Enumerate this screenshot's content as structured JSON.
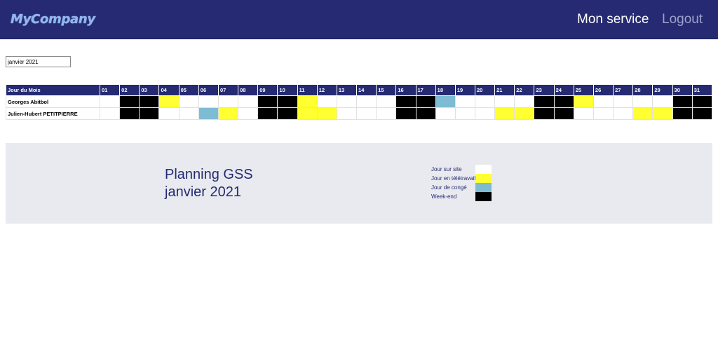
{
  "navbar": {
    "brand": "MyCompany",
    "links": [
      {
        "label": "Mon service"
      },
      {
        "label": "Logout"
      }
    ]
  },
  "month_selector": {
    "value": "janvier 2021"
  },
  "planning_table": {
    "header_label": "Jour du Mois",
    "days": [
      "01",
      "02",
      "03",
      "04",
      "05",
      "06",
      "07",
      "08",
      "09",
      "10",
      "11",
      "12",
      "13",
      "14",
      "15",
      "16",
      "17",
      "18",
      "19",
      "20",
      "21",
      "22",
      "23",
      "24",
      "25",
      "26",
      "27",
      "28",
      "29",
      "30",
      "31"
    ],
    "rows": [
      {
        "name": "Georges Abitbol",
        "days": [
          "site",
          "weekend",
          "weekend",
          "tele",
          "site",
          "site",
          "site",
          "site",
          "weekend",
          "weekend",
          "tele",
          "site",
          "site",
          "site",
          "site",
          "weekend",
          "weekend",
          "conge",
          "site",
          "site",
          "site",
          "site",
          "weekend",
          "weekend",
          "tele",
          "site",
          "site",
          "site",
          "site",
          "weekend",
          "weekend"
        ]
      },
      {
        "name": "Julien-Hubert PETITPIERRE",
        "days": [
          "site",
          "weekend",
          "weekend",
          "site",
          "site",
          "conge",
          "tele",
          "site",
          "weekend",
          "weekend",
          "tele",
          "tele",
          "site",
          "site",
          "site",
          "weekend",
          "weekend",
          "site",
          "site",
          "site",
          "tele",
          "tele",
          "weekend",
          "weekend",
          "site",
          "site",
          "site",
          "tele",
          "tele",
          "weekend",
          "weekend"
        ]
      }
    ]
  },
  "info_panel": {
    "title_line1": "Planning GSS",
    "title_line2": "janvier 2021"
  },
  "legend": [
    {
      "label": "Jour sur site",
      "color": "#ffffff"
    },
    {
      "label": "Jour en télétravail",
      "color": "#ffff33"
    },
    {
      "label": "Jour de congé",
      "color": "#7ebcd4"
    },
    {
      "label": "Week-end",
      "color": "#000000"
    }
  ],
  "colors": {
    "navbar_bg": "#252a72",
    "brand": "#8fb6f0",
    "panel_bg": "#e8eaef",
    "site": "#ffffff",
    "tele": "#ffff33",
    "conge": "#7ebcd4",
    "weekend": "#000000"
  }
}
